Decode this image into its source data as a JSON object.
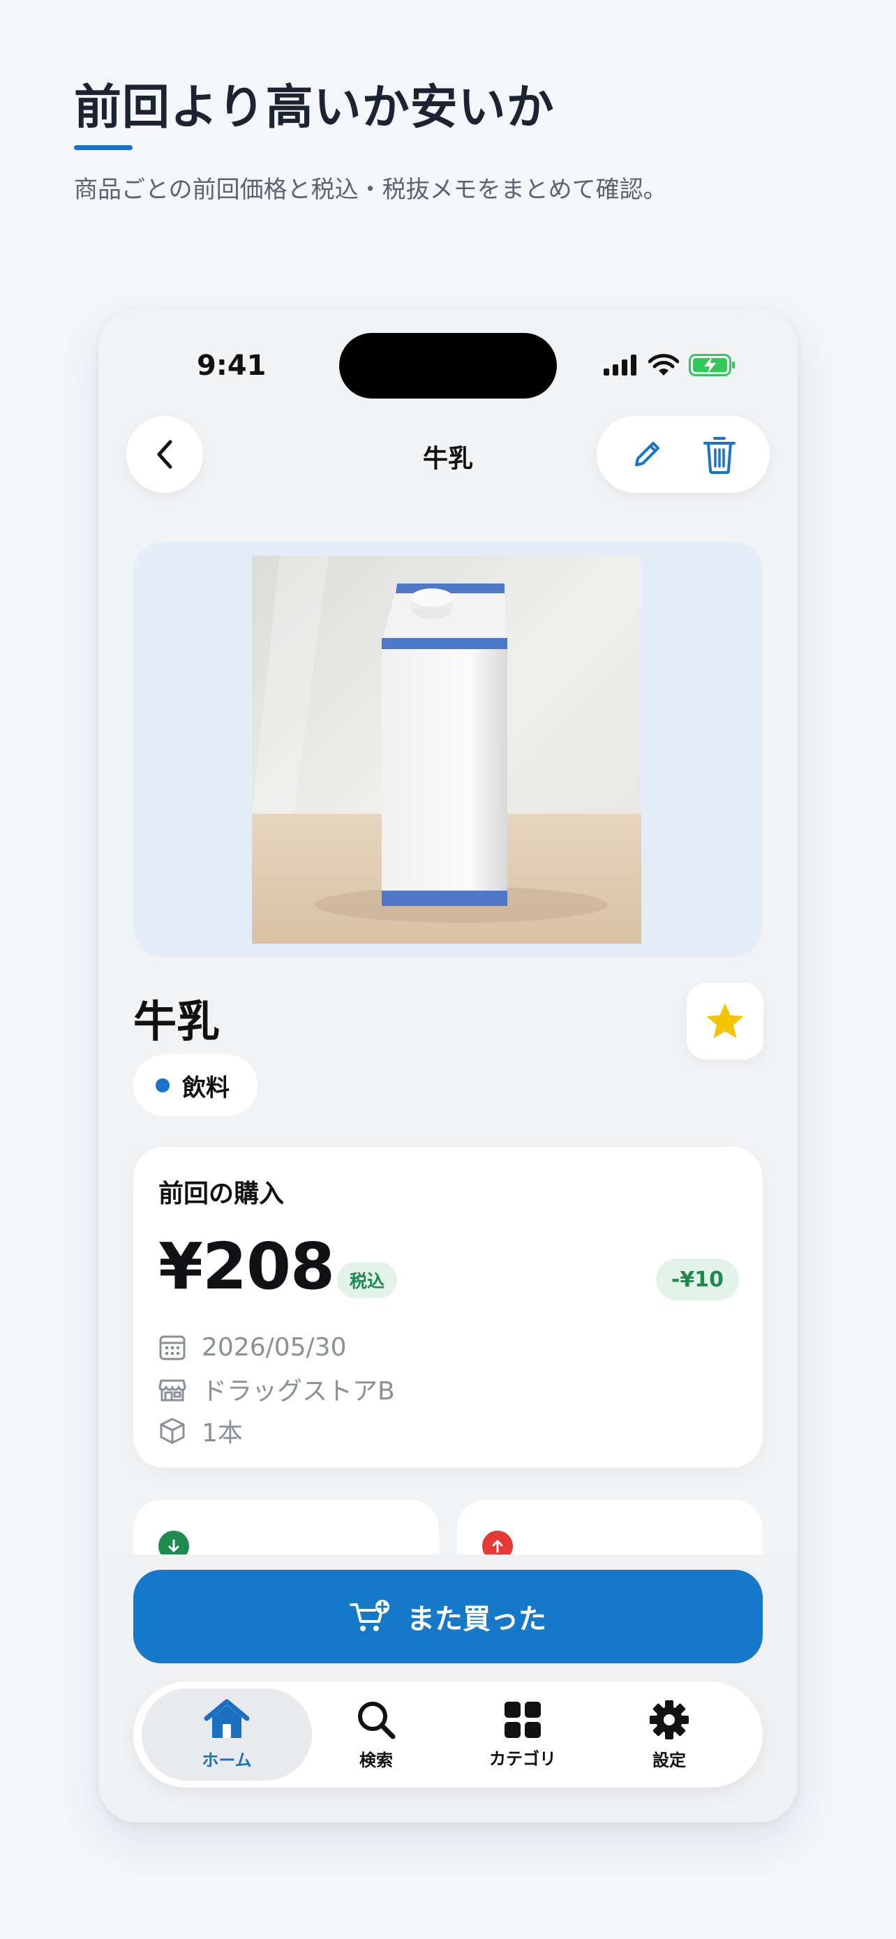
{
  "promo": {
    "headline": "前回より高いか安いか",
    "subheadline": "商品ごとの前回価格と税込・税抜メモをまとめて確認。"
  },
  "status_bar": {
    "time": "9:41"
  },
  "nav": {
    "title": "牛乳"
  },
  "product": {
    "name": "牛乳",
    "category": "飲料",
    "favorite": true
  },
  "last_purchase": {
    "title": "前回の購入",
    "price": "¥208",
    "tax_label": "税込",
    "diff": "-¥10",
    "date": "2026/05/30",
    "store": "ドラッグストアB",
    "quantity": "1本"
  },
  "cta": {
    "label": "また買った"
  },
  "tabs": [
    {
      "label": "ホーム",
      "icon": "home-icon",
      "active": true
    },
    {
      "label": "検索",
      "icon": "search-icon",
      "active": false
    },
    {
      "label": "カテゴリ",
      "icon": "grid-icon",
      "active": false
    },
    {
      "label": "設定",
      "icon": "gear-icon",
      "active": false
    }
  ],
  "colors": {
    "accent": "#1678c8",
    "positive": "#1e8a4e",
    "negative": "#e53935",
    "star": "#f5c400"
  }
}
